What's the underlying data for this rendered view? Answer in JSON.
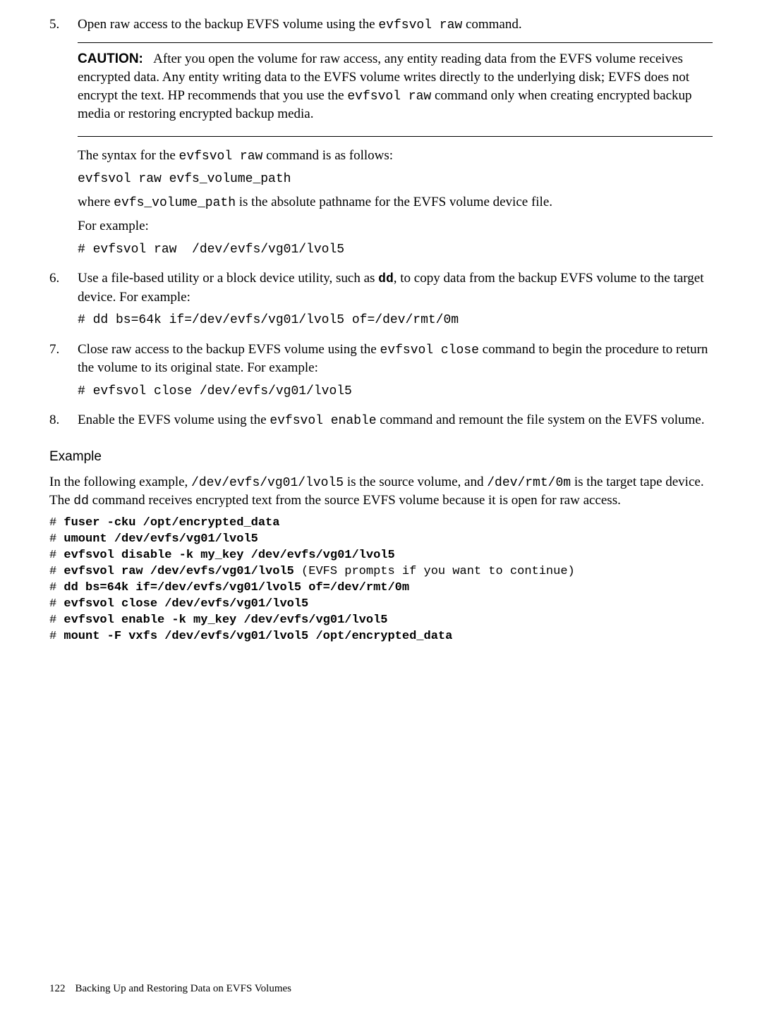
{
  "steps": {
    "s5": {
      "num": "5.",
      "intro_a": "Open raw access to the backup EVFS volume using the ",
      "intro_code": "evfsvol raw",
      "intro_b": " command.",
      "caution_label": "CAUTION:",
      "caution_body": "After you open the volume for raw access, any entity reading data from the EVFS volume receives encrypted data. Any entity writing data to the EVFS volume writes directly to the underlying disk; EVFS does not encrypt the text. HP recommends that you use the ",
      "caution_code": "evfsvol raw",
      "caution_body2": " command only when creating encrypted backup media or restoring encrypted backup media.",
      "syntax_a": "The syntax for the ",
      "syntax_code": "evfsvol raw",
      "syntax_b": " command is as follows:",
      "syntax_line": "evfsvol raw evfs_volume_path",
      "where_a": "where ",
      "where_code": "evfs_volume_path",
      "where_b": " is the absolute pathname for the EVFS volume device file.",
      "forex": "For example:",
      "ex_line": "# evfsvol raw  /dev/evfs/vg01/lvol5"
    },
    "s6": {
      "num": "6.",
      "a": "Use a file-based utility or a block device utility, such as ",
      "code": "dd",
      "b": ", to copy data from the backup EVFS volume to the target device. For example:",
      "ex_line": "# dd bs=64k if=/dev/evfs/vg01/lvol5 of=/dev/rmt/0m"
    },
    "s7": {
      "num": "7.",
      "a": "Close raw access to the backup EVFS volume using the ",
      "code": "evfsvol close",
      "b": " command to begin the procedure to return the volume to its original state. For example:",
      "ex_line": "# evfsvol close /dev/evfs/vg01/lvol5"
    },
    "s8": {
      "num": "8.",
      "a": "Enable the EVFS volume using the ",
      "code": "evfsvol enable",
      "b": " command and remount the file system on the EVFS volume."
    }
  },
  "example": {
    "heading": "Example",
    "para_a": "In the following example, ",
    "code1": "/dev/evfs/vg01/lvol5",
    "para_b": " is the source volume, and ",
    "code2": "/dev/rmt/0m",
    "para_c": " is the target tape device. The ",
    "code3": "dd",
    "para_d": " command receives encrypted text from the source EVFS volume because it is open for raw access.",
    "lines": {
      "l1p": "# ",
      "l1b": "fuser -cku /opt/encrypted_data",
      "l2p": "# ",
      "l2b": "umount /dev/evfs/vg01/lvol5",
      "l3p": "# ",
      "l3b": "evfsvol disable -k my_key /dev/evfs/vg01/lvol5",
      "l4p": "# ",
      "l4b": "evfsvol raw /dev/evfs/vg01/lvol5",
      "l4t": " (EVFS prompts if you want to continue)",
      "l5p": "# ",
      "l5b": "dd bs=64k if=/dev/evfs/vg01/lvol5 of=/dev/rmt/0m",
      "l6p": "# ",
      "l6b": "evfsvol close /dev/evfs/vg01/lvol5",
      "l7p": "# ",
      "l7b": "evfsvol enable -k my_key /dev/evfs/vg01/lvol5",
      "l8p": "# ",
      "l8b": "mount -F vxfs /dev/evfs/vg01/lvol5 /opt/encrypted_data"
    }
  },
  "footer": {
    "page": "122",
    "title": "Backing Up and Restoring Data on EVFS Volumes"
  }
}
